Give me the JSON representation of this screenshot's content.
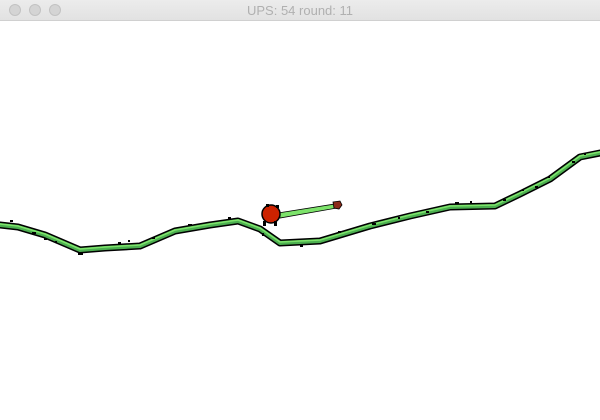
{
  "window": {
    "title_prefix": "UPS:",
    "ups": "54",
    "round_label": "round:",
    "round": "11",
    "buttons": [
      "close",
      "minimize",
      "zoom"
    ]
  },
  "colors": {
    "titlebar": "#e6e6e6",
    "title_text": "#b0b0b0",
    "terrain_fill": "#4caf50",
    "terrain_highlight": "#7de36b",
    "terrain_outline": "#000000",
    "player_body": "#cc2200",
    "aim_line": "#7de36b"
  },
  "scene": {
    "terrain": "green hilly line",
    "player": "red round creature",
    "aim": "green aim line ending in a red-brown marker"
  }
}
